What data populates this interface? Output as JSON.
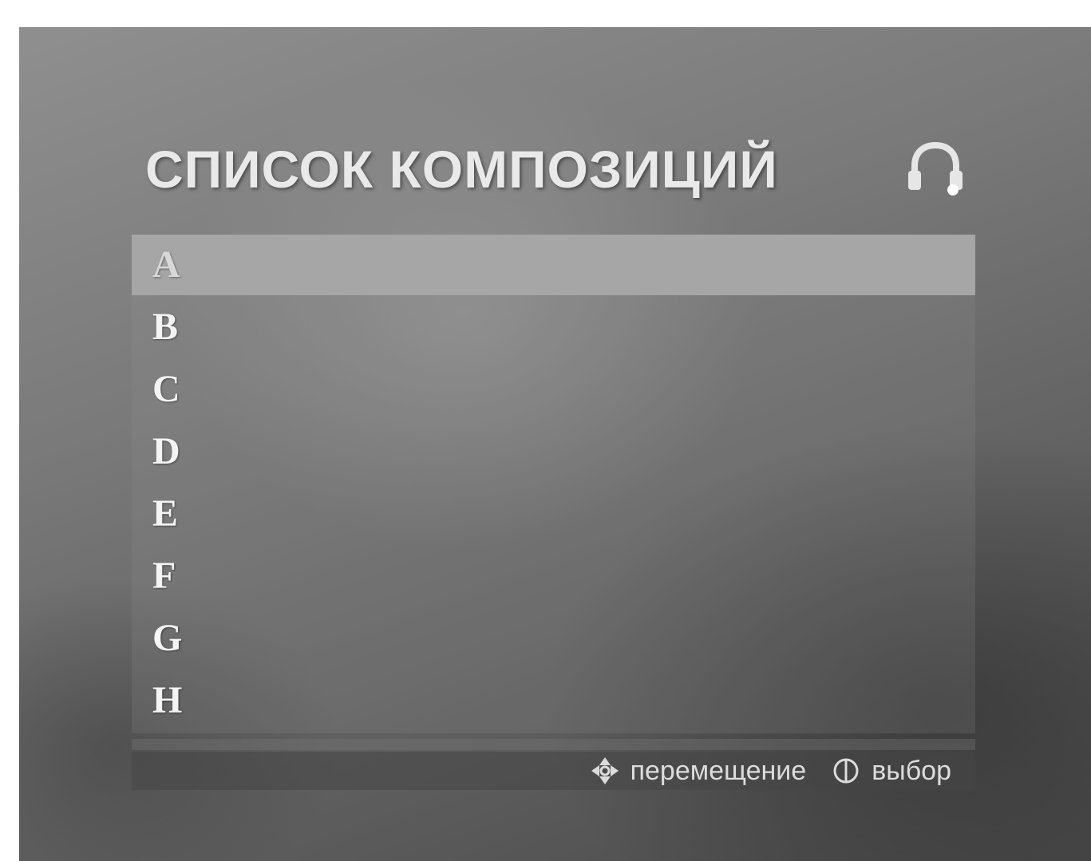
{
  "menu": {
    "title": "СПИСОК КОМПОЗИЦИЙ",
    "header_icon": "headphones-icon",
    "selected_index": 0,
    "items": [
      {
        "label": "A"
      },
      {
        "label": "B"
      },
      {
        "label": "C"
      },
      {
        "label": "D"
      },
      {
        "label": "E"
      },
      {
        "label": "F"
      },
      {
        "label": "G"
      },
      {
        "label": "H"
      }
    ]
  },
  "footer": {
    "move_icon": "dpad-arrows-icon",
    "move_label": "перемещение",
    "select_icon": "enter-button-icon",
    "select_label": "выбор"
  },
  "colors": {
    "selection_bar": "#a6a6a6",
    "text": "#f4f4f4"
  }
}
